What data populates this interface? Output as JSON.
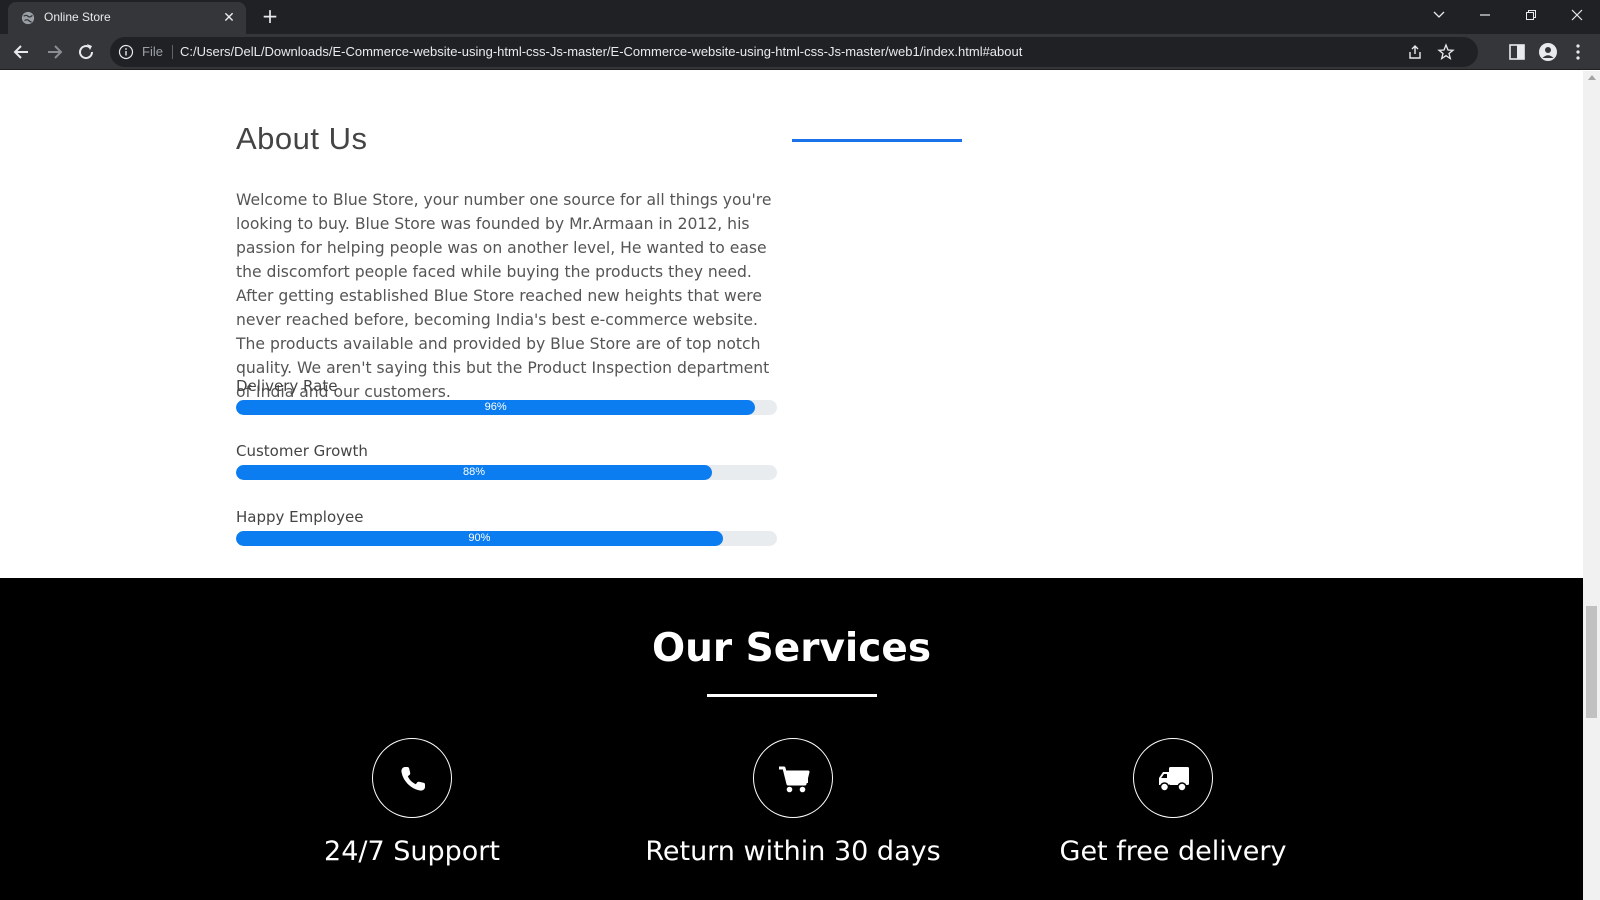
{
  "browser": {
    "tab_title": "Online Store",
    "address_prefix": "File",
    "url": "C:/Users/DelL/Downloads/E-Commerce-website-using-html-css-Js-master/E-Commerce-website-using-html-css-Js-master/web1/index.html#about"
  },
  "about": {
    "title": "About Us",
    "text": "Welcome to Blue Store, your number one source for all things you're looking to buy. Blue Store was founded by Mr.Armaan in 2012, his passion for helping people was on another level, He wanted to ease the discomfort people faced while buying the products they need. After getting established Blue Store reached new heights that were never reached before, becoming India's best e-commerce website. The products available and provided by Blue Store are of top notch quality. We aren't saying this but the Product Inspection department of India and our customers.",
    "skills": [
      {
        "label": "Delivery Rate",
        "value": 96,
        "value_text": "96%"
      },
      {
        "label": "Customer Growth",
        "value": 88,
        "value_text": "88%"
      },
      {
        "label": "Happy Employee",
        "value": 90,
        "value_text": "90%"
      }
    ],
    "accent_color": "#0b7df0"
  },
  "services": {
    "title": "Our Services",
    "items": [
      {
        "label": "24/7 Support",
        "icon": "phone-icon"
      },
      {
        "label": "Return within 30 days",
        "icon": "cart-icon"
      },
      {
        "label": "Get free delivery",
        "icon": "truck-icon"
      }
    ]
  }
}
